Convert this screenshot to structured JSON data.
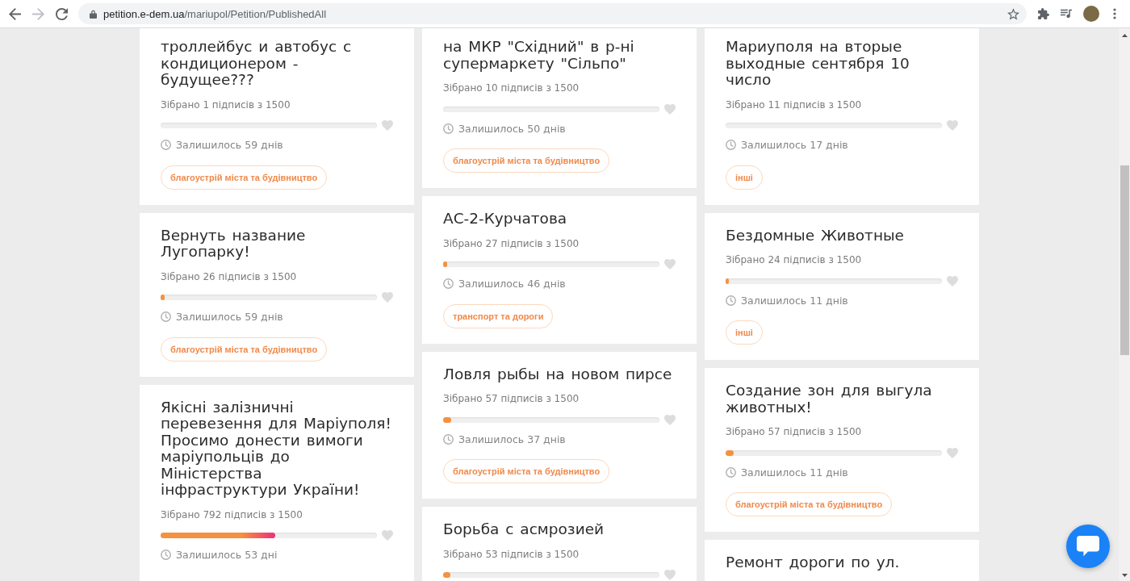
{
  "browser": {
    "back": {
      "disabled": false
    },
    "forward": {
      "disabled": true
    },
    "url": {
      "domain": "petition.e-dem.ua",
      "path": "/mariupol/Petition/PublishedAll"
    }
  },
  "columns": [
    {
      "petitions": [
        {
          "title": "троллейбус и автобус с кондиционером - будущее???",
          "signatures": "Зібрано 1 підписів з 1500",
          "days_left": "Залишилось 59 днів",
          "category": "благоустрій міста та будівництво"
        },
        {
          "title": "Вернуть название Лугопарку!",
          "signatures": "Зібрано 26 підписів з 1500",
          "level": 0.0173,
          "days_left": "Залишилось 59 днів",
          "category": "благоустрій міста та будівництво"
        },
        {
          "title": "Якісні залізничні перевезення для Маріуполя! Просимо донести вимоги маріупольців до Міністерства інфраструктури України!",
          "signatures": "Зібрано 792 підписів з 1500",
          "level": 0.528,
          "days_left": "Залишилось 53 дні"
        }
      ]
    },
    {
      "petitions": [
        {
          "title": "на МКР \"Східний\" в р-ні супермаркету \"Сільпо\"",
          "signatures": "Зібрано 10 підписів з 1500",
          "days_left": "Залишилось 50 днів",
          "category": "благоустрій міста та будівництво"
        },
        {
          "title": "АС-2-Курчатова",
          "signatures": "Зібрано 27 підписів з 1500",
          "level": 0.018,
          "days_left": "Залишилось 46 днів",
          "category": "транспорт та дороги"
        },
        {
          "title": "Ловля рыбы на новом пирсе",
          "signatures": "Зібрано 57 підписів з 1500",
          "level": 0.038,
          "days_left": "Залишилось 37 днів",
          "category": "благоустрій міста та будівництво"
        },
        {
          "title": "Борьба с асмрозией",
          "signatures": "Зібрано 53 підписів з 1500",
          "level": 0.0353
        }
      ]
    },
    {
      "petitions": [
        {
          "title": "Мариуполя на вторые выходные сентября 10 число",
          "signatures": "Зібрано 11 підписів з 1500",
          "days_left": "Залишилось 17 днів",
          "category": "інші"
        },
        {
          "title": "Бездомные Животные",
          "signatures": "Зібрано 24 підписів з 1500",
          "level": 0.016,
          "days_left": "Залишилось 11 днів",
          "category": "інші"
        },
        {
          "title": "Создание зон для выгула животных!",
          "signatures": "Зібрано 57 підписів з 1500",
          "level": 0.038,
          "days_left": "Залишилось 11 днів",
          "category": "благоустрій міста та будівництво"
        },
        {
          "title": "Ремонт дороги по ул."
        }
      ]
    }
  ]
}
